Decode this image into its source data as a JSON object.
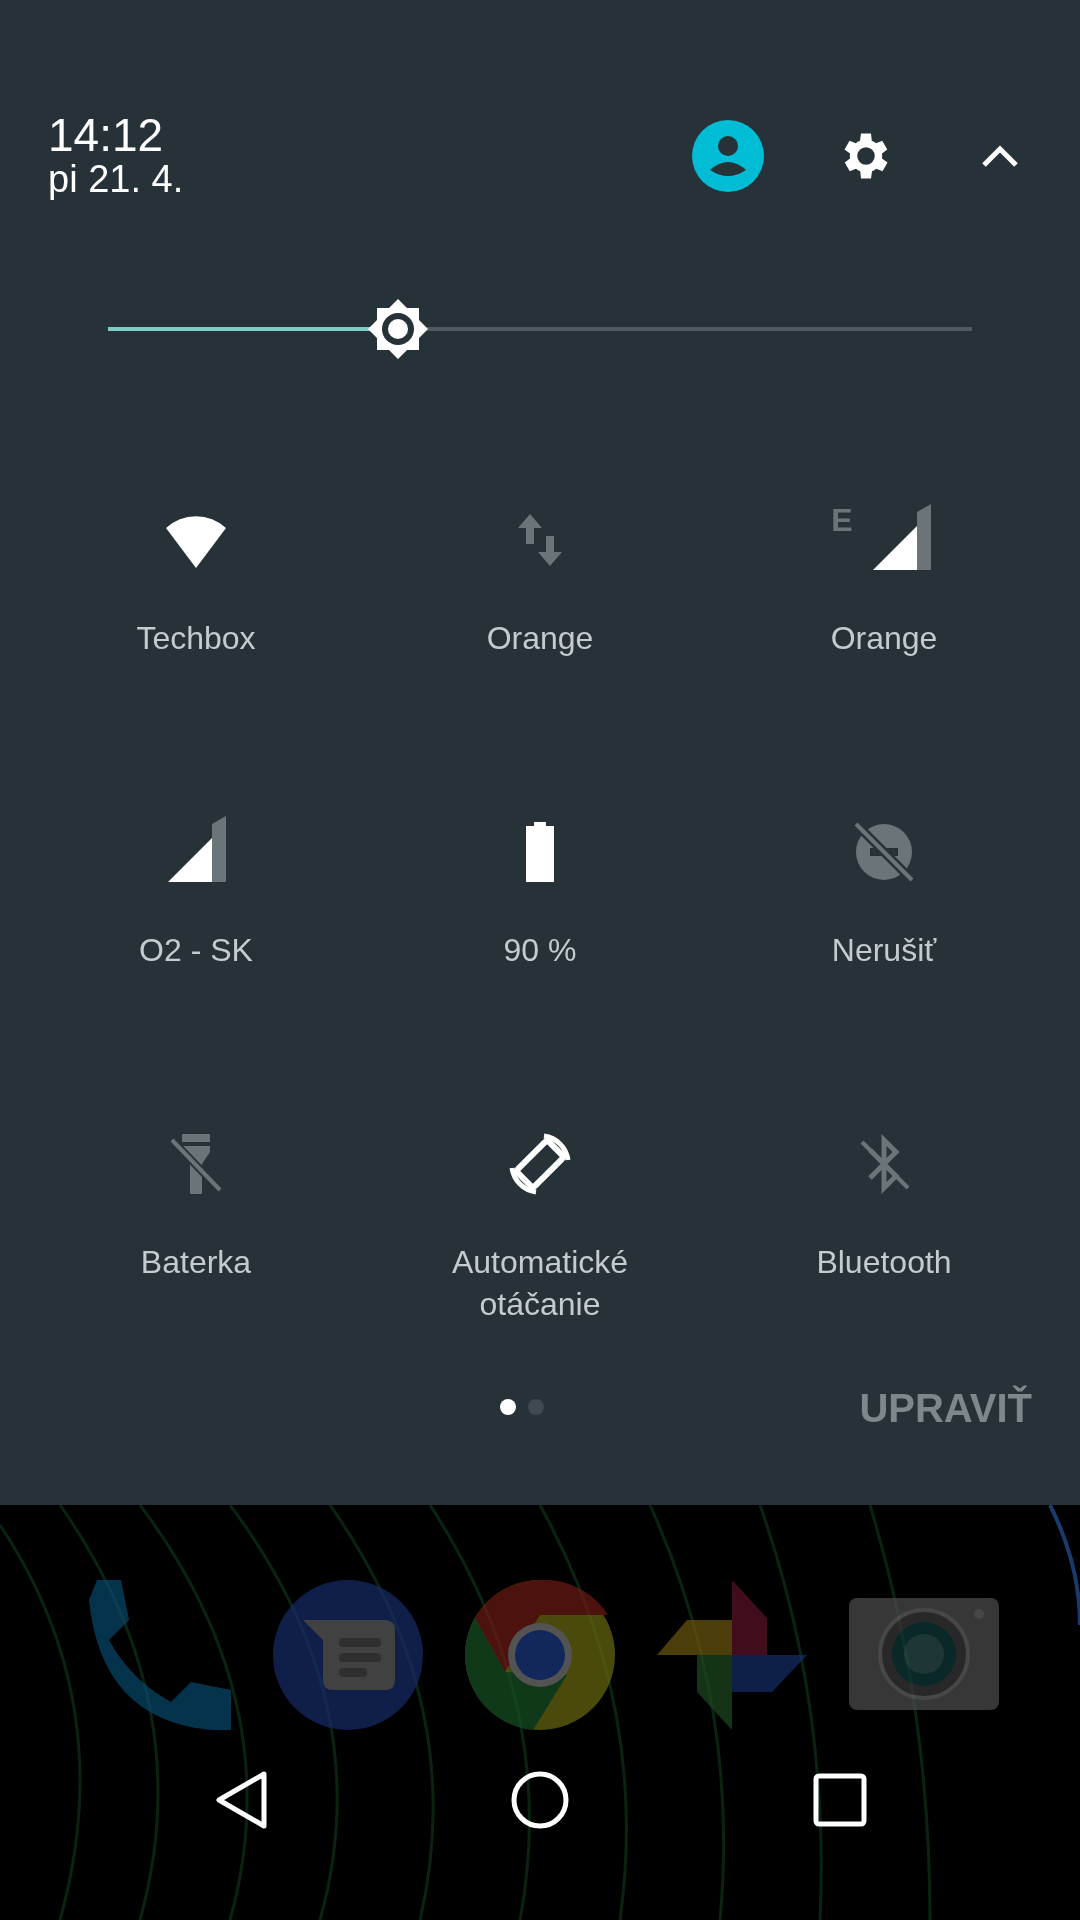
{
  "header": {
    "time": "14:12",
    "date": "pi 21. 4."
  },
  "brightness": {
    "level": 0.336
  },
  "tiles": [
    {
      "kind": "wifi",
      "label": "Techbox",
      "on": true
    },
    {
      "kind": "data",
      "label": "Orange",
      "on": false
    },
    {
      "kind": "cellular",
      "label": "Orange",
      "on": true
    },
    {
      "kind": "cellular",
      "label": "O2 - SK",
      "on": true
    },
    {
      "kind": "battery",
      "label": "90 %",
      "on": true
    },
    {
      "kind": "dnd",
      "label": "Nerušiť",
      "on": false
    },
    {
      "kind": "flashlight",
      "label": "Baterka",
      "on": false
    },
    {
      "kind": "rotate",
      "label": "Automatické otáčanie",
      "on": true
    },
    {
      "kind": "bluetooth",
      "label": "Bluetooth",
      "on": false
    }
  ],
  "pages": [
    {
      "selected": true
    },
    {
      "selected": false
    }
  ],
  "edit_button": "UPRAVIŤ",
  "mobile_network_type": "E"
}
